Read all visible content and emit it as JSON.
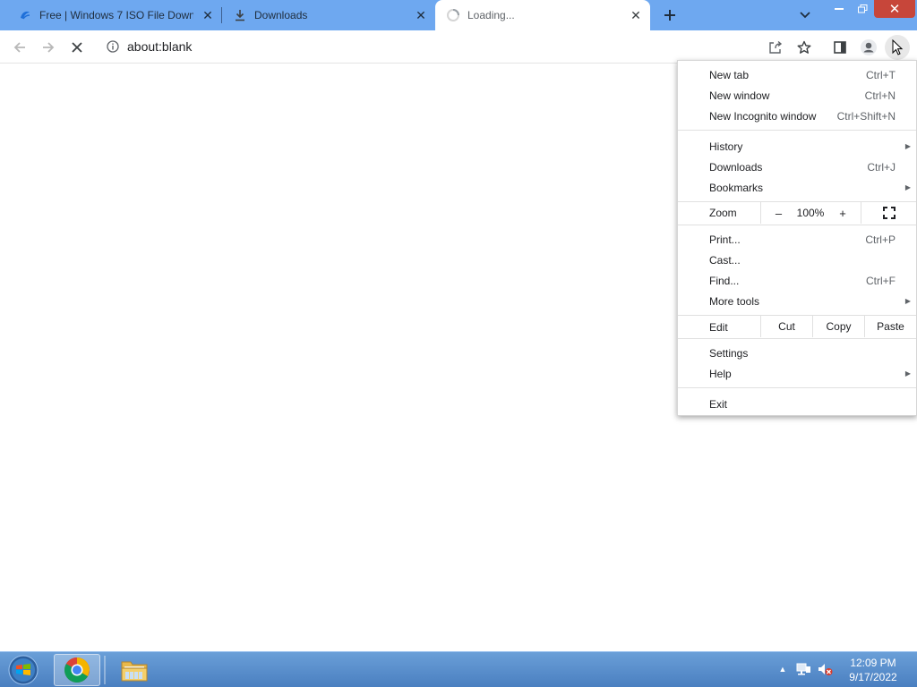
{
  "tabs": [
    {
      "title": "Free | Windows 7 ISO File Downl",
      "icon": "site-favicon-icon",
      "active": false
    },
    {
      "title": "Downloads",
      "icon": "download-icon",
      "active": false
    },
    {
      "title": "Loading...",
      "icon": "spinner-icon",
      "active": true
    }
  ],
  "omnibox": {
    "url": "about:blank"
  },
  "menu": {
    "new_tab": {
      "label": "New tab",
      "shortcut": "Ctrl+T"
    },
    "new_window": {
      "label": "New window",
      "shortcut": "Ctrl+N"
    },
    "new_incognito": {
      "label": "New Incognito window",
      "shortcut": "Ctrl+Shift+N"
    },
    "history": {
      "label": "History"
    },
    "downloads": {
      "label": "Downloads",
      "shortcut": "Ctrl+J"
    },
    "bookmarks": {
      "label": "Bookmarks"
    },
    "zoom": {
      "label": "Zoom",
      "minus": "–",
      "value": "100%",
      "plus": "+"
    },
    "print": {
      "label": "Print...",
      "shortcut": "Ctrl+P"
    },
    "cast": {
      "label": "Cast..."
    },
    "find": {
      "label": "Find...",
      "shortcut": "Ctrl+F"
    },
    "more_tools": {
      "label": "More tools"
    },
    "edit": {
      "label": "Edit",
      "cut": "Cut",
      "copy": "Copy",
      "paste": "Paste"
    },
    "settings": {
      "label": "Settings"
    },
    "help": {
      "label": "Help"
    },
    "exit": {
      "label": "Exit"
    }
  },
  "taskbar": {
    "apps": [
      "start-orb-icon",
      "chrome-icon",
      "file-explorer-icon"
    ],
    "clock": {
      "time": "12:09 PM",
      "date": "9/17/2022"
    }
  },
  "colors": {
    "tabstrip": "#6ea8f0",
    "close_button": "#c7463a",
    "taskbar": "#5a8fcc"
  }
}
